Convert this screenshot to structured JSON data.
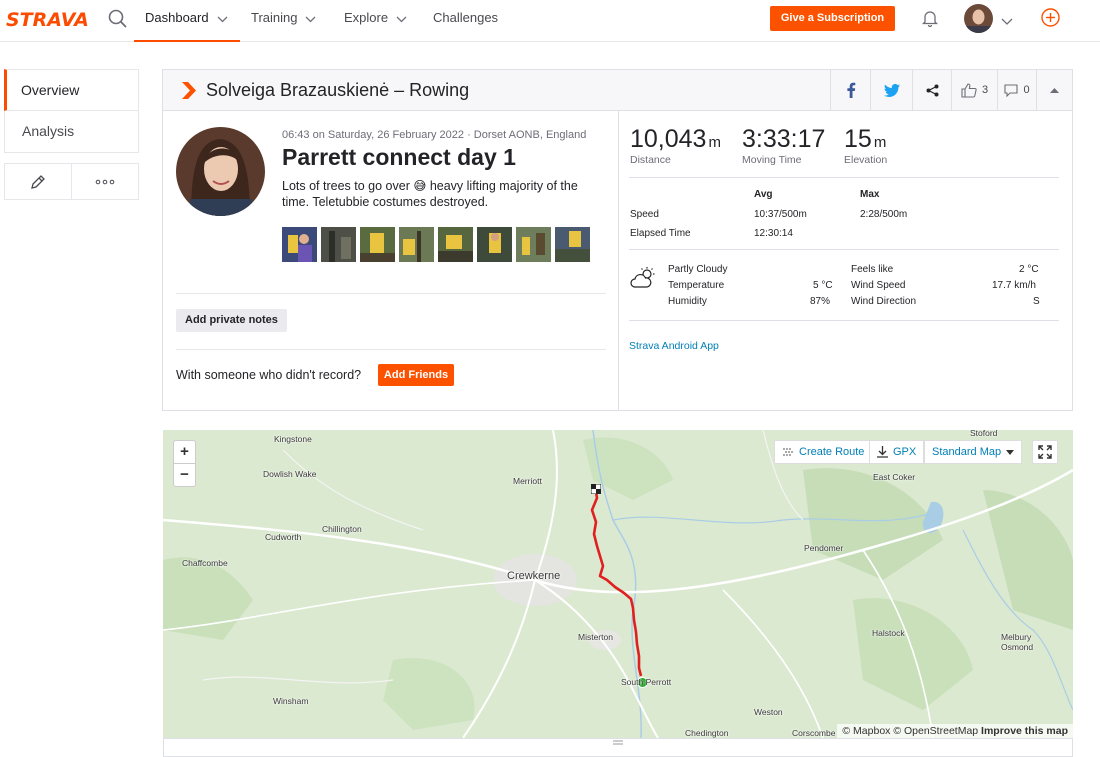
{
  "nav": {
    "logo": "STRAVA",
    "items": [
      {
        "label": "Dashboard"
      },
      {
        "label": "Training"
      },
      {
        "label": "Explore"
      },
      {
        "label": "Challenges"
      }
    ],
    "subscribe_label": "Give a Subscription"
  },
  "sidebar": {
    "items": [
      {
        "label": "Overview"
      },
      {
        "label": "Analysis"
      }
    ]
  },
  "activity": {
    "header_title": "Solveiga Brazauskienė – Rowing",
    "kudos_count": "3",
    "comment_count": "0",
    "meta": "06:43 on Saturday, 26 February 2022 · Dorset AONB, England",
    "title": "Parrett connect day 1",
    "description": "Lots of trees to go over 😅 heavy lifting majority of the time. Teletubbie costumes destroyed.",
    "photo_count": 8,
    "notes_button": "Add private notes",
    "friends_question": "With someone who didn't record?",
    "friends_button": "Add Friends"
  },
  "stats": {
    "distance": {
      "value": "10,043",
      "unit": "m",
      "label": "Distance"
    },
    "moving_time": {
      "value": "3:33:17",
      "label": "Moving Time"
    },
    "elevation": {
      "value": "15",
      "unit": "m",
      "label": "Elevation"
    },
    "table": {
      "avg_header": "Avg",
      "max_header": "Max",
      "speed_label": "Speed",
      "speed_avg": "10:37/500m",
      "speed_max": "2:28/500m",
      "elapsed_label": "Elapsed Time",
      "elapsed_value": "12:30:14"
    },
    "weather": {
      "condition": "Partly Cloudy",
      "temperature_label": "Temperature",
      "temperature_value": "5 °C",
      "humidity_label": "Humidity",
      "humidity_value": "87%",
      "feels_like_label": "Feels like",
      "feels_like_value": "2 °C",
      "wind_speed_label": "Wind Speed",
      "wind_speed_value": "17.7 km/h",
      "wind_direction_label": "Wind Direction",
      "wind_direction_value": "S"
    },
    "device": "Strava Android App"
  },
  "map": {
    "create_route": "Create Route",
    "gpx": "GPX",
    "map_style": "Standard Map",
    "attribution_mapbox": "© Mapbox",
    "attribution_osm": "© OpenStreetMap",
    "improve": "Improve this map",
    "places": [
      {
        "name": "Kingstone"
      },
      {
        "name": "Dowlish Wake"
      },
      {
        "name": "Merriott"
      },
      {
        "name": "Chillington"
      },
      {
        "name": "Cudworth"
      },
      {
        "name": "Chaffcombe"
      },
      {
        "name": "Crewkerne"
      },
      {
        "name": "Misterton"
      },
      {
        "name": "South Perrott"
      },
      {
        "name": "Winsham"
      },
      {
        "name": "Weston"
      },
      {
        "name": "Chedington"
      },
      {
        "name": "Corscombe"
      },
      {
        "name": "Halstock"
      },
      {
        "name": "Melbury Osmond"
      },
      {
        "name": "Pendomer"
      },
      {
        "name": "East Coker"
      },
      {
        "name": "Stoford"
      }
    ]
  }
}
